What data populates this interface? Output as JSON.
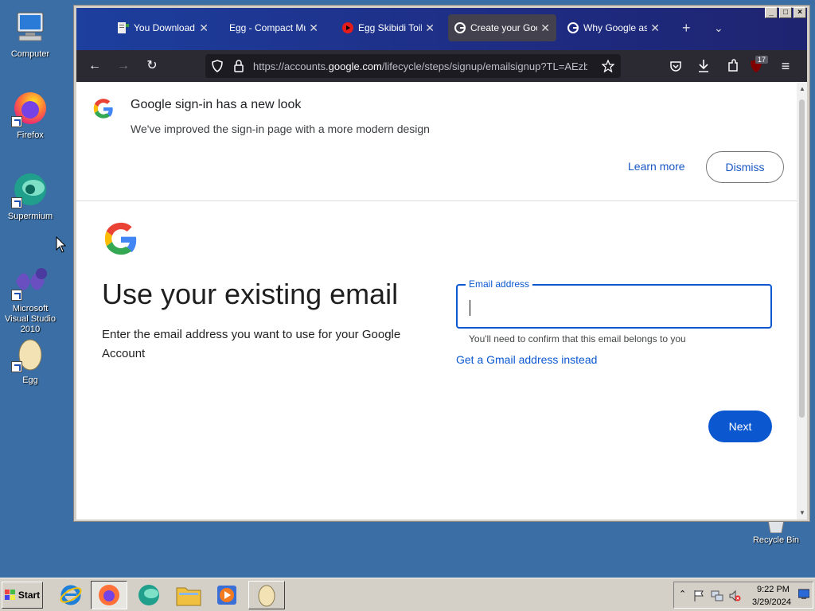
{
  "desktop": {
    "icons": [
      {
        "label": "Computer"
      },
      {
        "label": "Firefox"
      },
      {
        "label": "Supermium"
      },
      {
        "label": "Microsoft Visual Studio 2010"
      },
      {
        "label": "Egg"
      }
    ],
    "recycle_bin": "Recycle Bin"
  },
  "browser": {
    "tabs": [
      {
        "title": "You Download"
      },
      {
        "title": "Egg - Compact Multifu"
      },
      {
        "title": "Egg Skibidi Toilet"
      },
      {
        "title": "Create your Googl"
      },
      {
        "title": "Why Google asks"
      }
    ],
    "url_prefix": "https://accounts.",
    "url_domain": "google.com",
    "url_suffix": "/lifecycle/steps/signup/emailsignup?TL=AEzbmx",
    "extension_badge": "17"
  },
  "banner": {
    "title": "Google sign-in has a new look",
    "subtitle": "We've improved the sign-in page with a more modern design",
    "learn_more": "Learn more",
    "dismiss": "Dismiss"
  },
  "main": {
    "heading": "Use your existing email",
    "description": "Enter the email address you want to use for your Google Account",
    "email_label": "Email address",
    "email_value": "",
    "helper": "You'll need to confirm that this email belongs to you",
    "gmail_link": "Get a Gmail address instead",
    "next": "Next"
  },
  "taskbar": {
    "start": "Start",
    "time": "9:22 PM",
    "date": "3/29/2024"
  },
  "colors": {
    "accent": "#0b57d0",
    "desktop": "#3a6ea5",
    "taskbar": "#d4d0c8"
  }
}
